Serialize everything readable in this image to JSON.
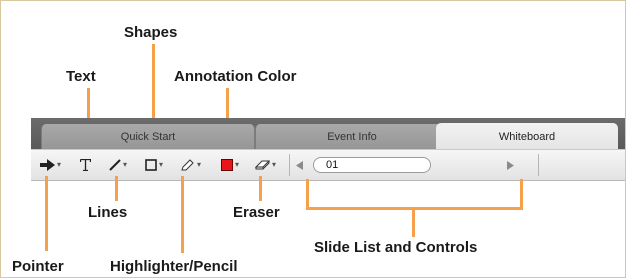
{
  "callouts": {
    "shapes": "Shapes",
    "text": "Text",
    "annotation_color": "Annotation Color",
    "lines": "Lines",
    "eraser": "Eraser",
    "pointer": "Pointer",
    "highlighter_pencil": "Highlighter/Pencil",
    "slide_list_controls": "Slide List and Controls"
  },
  "tabs": [
    {
      "label": "Quick Start",
      "active": false
    },
    {
      "label": "Event Info",
      "active": false
    },
    {
      "label": "Whiteboard",
      "active": true
    }
  ],
  "toolbar": {
    "tools": [
      {
        "name": "pointer",
        "icon": "arrow-right-icon"
      },
      {
        "name": "text",
        "icon": "text-t-icon"
      },
      {
        "name": "lines",
        "icon": "line-icon"
      },
      {
        "name": "shapes",
        "icon": "rectangle-icon"
      },
      {
        "name": "highlighter-pencil",
        "icon": "pencil-icon"
      },
      {
        "name": "annotation-color",
        "icon": "color-swatch-icon"
      },
      {
        "name": "eraser",
        "icon": "eraser-icon"
      }
    ],
    "annotation_color": "#e8151a",
    "slide_input_value": "01"
  },
  "colors": {
    "callout_line": "#f5a04a",
    "frame_border": "#d8c8a0"
  }
}
